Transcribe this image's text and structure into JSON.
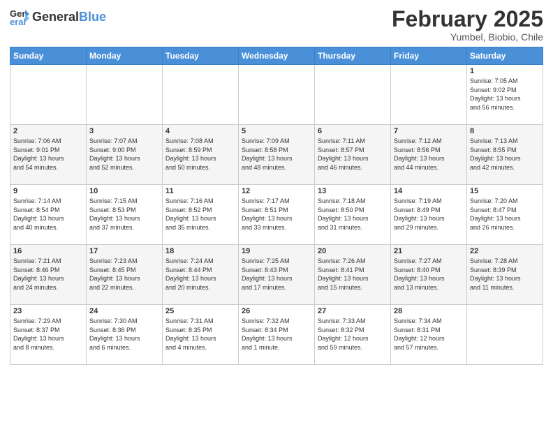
{
  "logo": {
    "general": "General",
    "blue": "Blue"
  },
  "header": {
    "month": "February 2025",
    "location": "Yumbel, Biobio, Chile"
  },
  "weekdays": [
    "Sunday",
    "Monday",
    "Tuesday",
    "Wednesday",
    "Thursday",
    "Friday",
    "Saturday"
  ],
  "weeks": [
    [
      {
        "day": "",
        "info": ""
      },
      {
        "day": "",
        "info": ""
      },
      {
        "day": "",
        "info": ""
      },
      {
        "day": "",
        "info": ""
      },
      {
        "day": "",
        "info": ""
      },
      {
        "day": "",
        "info": ""
      },
      {
        "day": "1",
        "info": "Sunrise: 7:05 AM\nSunset: 9:02 PM\nDaylight: 13 hours\nand 56 minutes."
      }
    ],
    [
      {
        "day": "2",
        "info": "Sunrise: 7:06 AM\nSunset: 9:01 PM\nDaylight: 13 hours\nand 54 minutes."
      },
      {
        "day": "3",
        "info": "Sunrise: 7:07 AM\nSunset: 9:00 PM\nDaylight: 13 hours\nand 52 minutes."
      },
      {
        "day": "4",
        "info": "Sunrise: 7:08 AM\nSunset: 8:59 PM\nDaylight: 13 hours\nand 50 minutes."
      },
      {
        "day": "5",
        "info": "Sunrise: 7:09 AM\nSunset: 8:58 PM\nDaylight: 13 hours\nand 48 minutes."
      },
      {
        "day": "6",
        "info": "Sunrise: 7:11 AM\nSunset: 8:57 PM\nDaylight: 13 hours\nand 46 minutes."
      },
      {
        "day": "7",
        "info": "Sunrise: 7:12 AM\nSunset: 8:56 PM\nDaylight: 13 hours\nand 44 minutes."
      },
      {
        "day": "8",
        "info": "Sunrise: 7:13 AM\nSunset: 8:55 PM\nDaylight: 13 hours\nand 42 minutes."
      }
    ],
    [
      {
        "day": "9",
        "info": "Sunrise: 7:14 AM\nSunset: 8:54 PM\nDaylight: 13 hours\nand 40 minutes."
      },
      {
        "day": "10",
        "info": "Sunrise: 7:15 AM\nSunset: 8:53 PM\nDaylight: 13 hours\nand 37 minutes."
      },
      {
        "day": "11",
        "info": "Sunrise: 7:16 AM\nSunset: 8:52 PM\nDaylight: 13 hours\nand 35 minutes."
      },
      {
        "day": "12",
        "info": "Sunrise: 7:17 AM\nSunset: 8:51 PM\nDaylight: 13 hours\nand 33 minutes."
      },
      {
        "day": "13",
        "info": "Sunrise: 7:18 AM\nSunset: 8:50 PM\nDaylight: 13 hours\nand 31 minutes."
      },
      {
        "day": "14",
        "info": "Sunrise: 7:19 AM\nSunset: 8:49 PM\nDaylight: 13 hours\nand 29 minutes."
      },
      {
        "day": "15",
        "info": "Sunrise: 7:20 AM\nSunset: 8:47 PM\nDaylight: 13 hours\nand 26 minutes."
      }
    ],
    [
      {
        "day": "16",
        "info": "Sunrise: 7:21 AM\nSunset: 8:46 PM\nDaylight: 13 hours\nand 24 minutes."
      },
      {
        "day": "17",
        "info": "Sunrise: 7:23 AM\nSunset: 8:45 PM\nDaylight: 13 hours\nand 22 minutes."
      },
      {
        "day": "18",
        "info": "Sunrise: 7:24 AM\nSunset: 8:44 PM\nDaylight: 13 hours\nand 20 minutes."
      },
      {
        "day": "19",
        "info": "Sunrise: 7:25 AM\nSunset: 8:43 PM\nDaylight: 13 hours\nand 17 minutes."
      },
      {
        "day": "20",
        "info": "Sunrise: 7:26 AM\nSunset: 8:41 PM\nDaylight: 13 hours\nand 15 minutes."
      },
      {
        "day": "21",
        "info": "Sunrise: 7:27 AM\nSunset: 8:40 PM\nDaylight: 13 hours\nand 13 minutes."
      },
      {
        "day": "22",
        "info": "Sunrise: 7:28 AM\nSunset: 8:39 PM\nDaylight: 13 hours\nand 11 minutes."
      }
    ],
    [
      {
        "day": "23",
        "info": "Sunrise: 7:29 AM\nSunset: 8:37 PM\nDaylight: 13 hours\nand 8 minutes."
      },
      {
        "day": "24",
        "info": "Sunrise: 7:30 AM\nSunset: 8:36 PM\nDaylight: 13 hours\nand 6 minutes."
      },
      {
        "day": "25",
        "info": "Sunrise: 7:31 AM\nSunset: 8:35 PM\nDaylight: 13 hours\nand 4 minutes."
      },
      {
        "day": "26",
        "info": "Sunrise: 7:32 AM\nSunset: 8:34 PM\nDaylight: 13 hours\nand 1 minute."
      },
      {
        "day": "27",
        "info": "Sunrise: 7:33 AM\nSunset: 8:32 PM\nDaylight: 12 hours\nand 59 minutes."
      },
      {
        "day": "28",
        "info": "Sunrise: 7:34 AM\nSunset: 8:31 PM\nDaylight: 12 hours\nand 57 minutes."
      },
      {
        "day": "",
        "info": ""
      }
    ]
  ]
}
